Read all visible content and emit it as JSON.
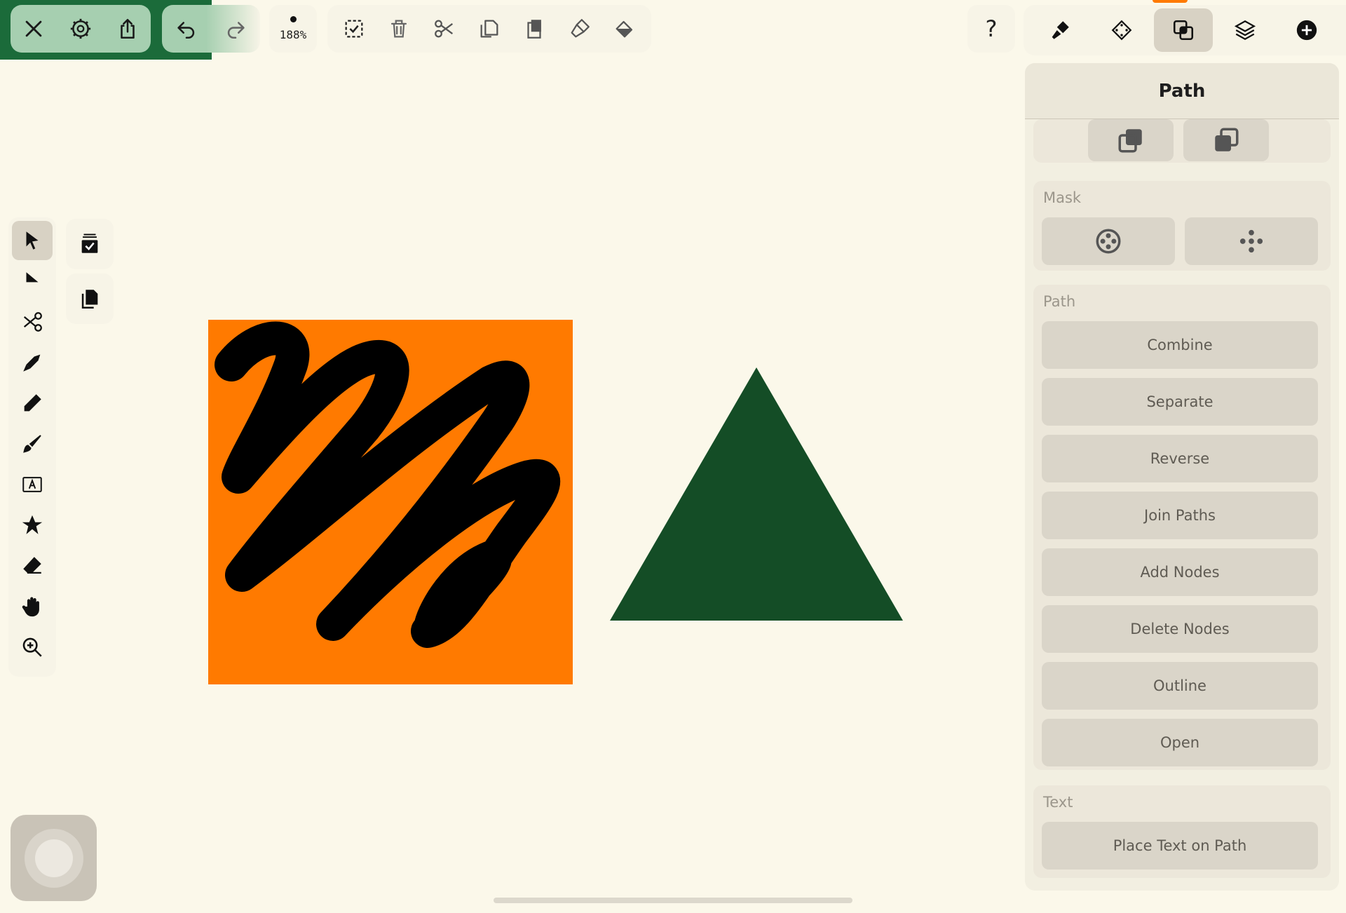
{
  "toolbar": {
    "zoom_level": "188%",
    "help_label": "?"
  },
  "inspector": {
    "title": "Path",
    "mask_title": "Mask",
    "path_title": "Path",
    "path_buttons": [
      "Combine",
      "Separate",
      "Reverse",
      "Join Paths",
      "Add Nodes",
      "Delete Nodes",
      "Outline",
      "Open"
    ],
    "text_title": "Text",
    "text_buttons": [
      "Place Text on Path"
    ]
  },
  "canvas": {
    "shapes": [
      {
        "kind": "square",
        "color": "#ff7a00"
      },
      {
        "kind": "scribble",
        "color": "#000000"
      },
      {
        "kind": "triangle",
        "color": "#144d26"
      }
    ]
  },
  "colors": {
    "accent_green": "#1b6b3a",
    "panel_bg": "#f2efe1",
    "button_bg": "#dad5c9",
    "canvas_bg": "#fbf8ea"
  }
}
